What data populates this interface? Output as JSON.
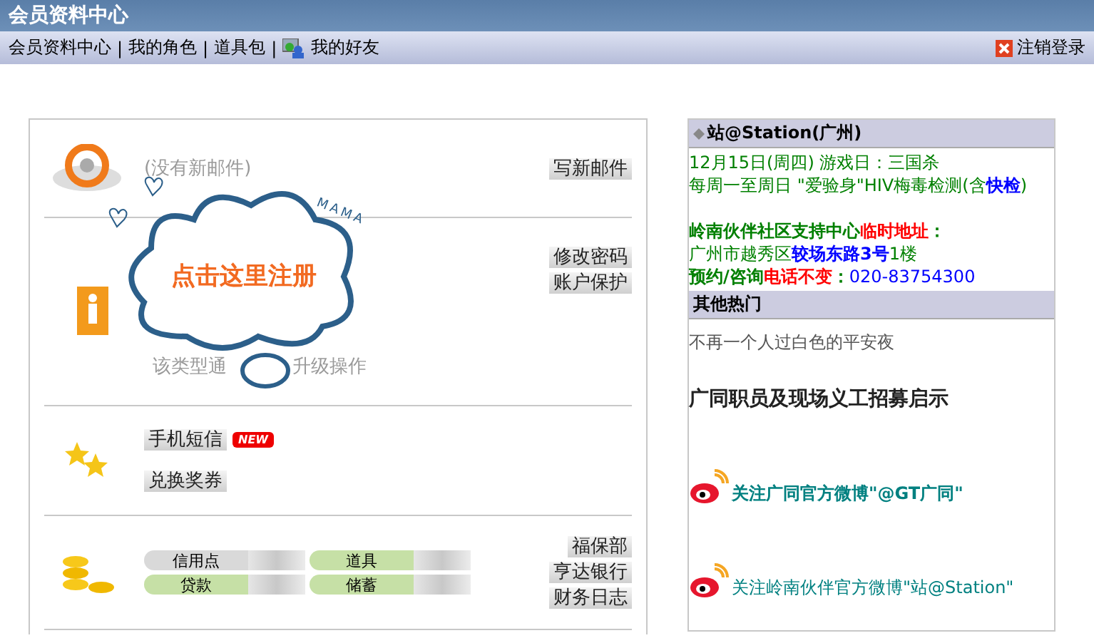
{
  "header": {
    "title": "会员资料中心"
  },
  "nav": {
    "items": [
      {
        "label": "会员资料中心",
        "icon": false
      },
      {
        "label": "我的角色",
        "icon": false
      },
      {
        "label": "道具包",
        "icon": false
      },
      {
        "label": "我的好友",
        "icon": true
      }
    ],
    "separator": "|",
    "logout": "注销登录"
  },
  "mail": {
    "status": "(没有新邮件)",
    "button": "写新邮件"
  },
  "account": {
    "buttons": [
      "修改密码",
      "账户保护"
    ],
    "note_left": "该类型通",
    "note_right": "升级操作"
  },
  "sms": {
    "buttons": [
      "手机短信",
      "兑换奖券"
    ],
    "badge": "NEW"
  },
  "finance": {
    "pills": [
      {
        "label": "信用点",
        "color": "#d9d9d9"
      },
      {
        "label": "道具",
        "color": "#c6e0a6"
      },
      {
        "label": "贷款",
        "color": "#c6e0a6"
      },
      {
        "label": "储蓄",
        "color": "#c6e0a6"
      }
    ],
    "buttons": [
      "福保部",
      "亨达银行",
      "财务日志"
    ]
  },
  "register_cloud": {
    "label": "点击这里注册",
    "scribble": "MAMA"
  },
  "station": {
    "title": "站@Station(广州)",
    "lines": [
      {
        "kind": "line",
        "segments": [
          {
            "text": "12月15日(周四) 游戏日：三国杀",
            "color": "#008000",
            "bold": false
          }
        ]
      },
      {
        "kind": "line",
        "segments": [
          {
            "text": "每周一至周日 \"爱验身\"HIV梅毒检测(含",
            "color": "#008000",
            "bold": false
          },
          {
            "text": "快检",
            "color": "#0000ff",
            "bold": true
          },
          {
            "text": ")",
            "color": "#008000",
            "bold": false
          }
        ]
      },
      {
        "kind": "paragraph",
        "segments": [
          {
            "text": "岭南伙伴社区支持中心",
            "color": "#008000",
            "bold": true
          },
          {
            "text": "临时地址",
            "color": "#ff0000",
            "bold": true
          },
          {
            "text": "：",
            "color": "#008000",
            "bold": true
          }
        ]
      },
      {
        "kind": "line",
        "segments": [
          {
            "text": "广州市越秀区",
            "color": "#008000",
            "bold": false
          },
          {
            "text": "较场东路3号",
            "color": "#0000ff",
            "bold": true
          },
          {
            "text": "1楼",
            "color": "#008000",
            "bold": false
          }
        ]
      },
      {
        "kind": "line",
        "segments": [
          {
            "text": "预约/咨询",
            "color": "#008000",
            "bold": true
          },
          {
            "text": "电话不变",
            "color": "#ff0000",
            "bold": true
          },
          {
            "text": "：",
            "color": "#008000",
            "bold": true
          },
          {
            "text": "020-83754300",
            "color": "#0000ff",
            "bold": false
          }
        ]
      }
    ]
  },
  "hot": {
    "title": "其他热门",
    "items": [
      {
        "kind": "plain",
        "text": "不再一个人过白色的平安夜"
      },
      {
        "kind": "headline",
        "text": "广同职员及现场义工招募启示"
      },
      {
        "kind": "weibo-bold",
        "text": "关注广同官方微博\"@GT广同\""
      },
      {
        "kind": "weibo",
        "text": "关注岭南伙伴官方微博\"站@Station\""
      }
    ]
  }
}
